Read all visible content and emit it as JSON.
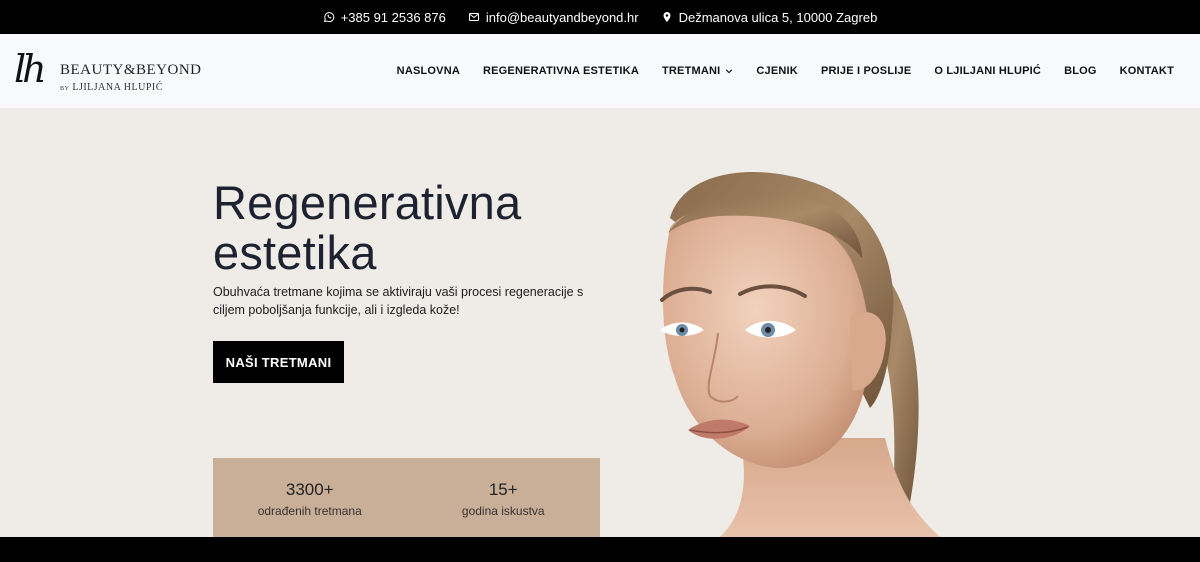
{
  "topbar": {
    "phone": "+385 91 2536 876",
    "email": "info@beautyandbeyond.hr",
    "address": "Dežmanova ulica 5, 10000 Zagreb"
  },
  "logo": {
    "monogram": "lh",
    "brand": "BEAUTY&BEYOND",
    "by": "BY",
    "owner": "LJILJANA HLUPIĆ"
  },
  "nav": {
    "items": [
      {
        "label": "NASLOVNA"
      },
      {
        "label": "REGENERATIVNA ESTETIKA"
      },
      {
        "label": "TRETMANI",
        "has_dropdown": true
      },
      {
        "label": "CJENIK"
      },
      {
        "label": "PRIJE I POSLIJE"
      },
      {
        "label": "O LJILJANI HLUPIĆ"
      },
      {
        "label": "BLOG"
      },
      {
        "label": "KONTAKT"
      }
    ]
  },
  "hero": {
    "title_line1": "Regenerativna",
    "title_line2": "estetika",
    "description": "Obuhvaća tretmane kojima se aktiviraju vaši procesi regeneracije s ciljem poboljšanja funkcije, ali i izgleda kože!",
    "cta_label": "NAŠI TRETMANI",
    "stats": [
      {
        "value": "3300+",
        "label": "odrađenih tretmana"
      },
      {
        "value": "15+",
        "label": "godina iskustva"
      }
    ]
  },
  "colors": {
    "hero_bg": "#efebe7",
    "stats_bg": "#c9ae98",
    "title": "#1c2230",
    "topbar_bg": "#000000"
  }
}
